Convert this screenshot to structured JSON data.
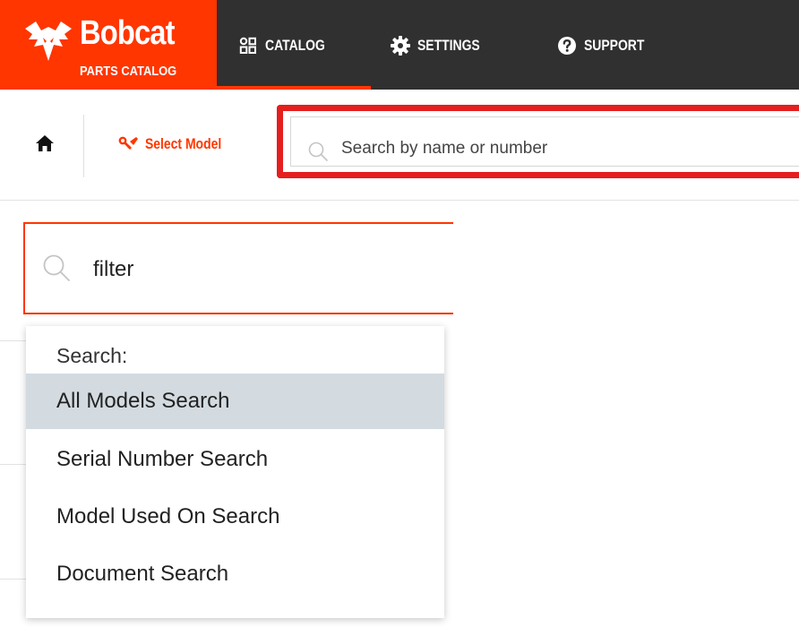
{
  "brand": {
    "name": "Bobcat",
    "subtitle": "PARTS CATALOG",
    "color": "#ff3600"
  },
  "nav": {
    "items": [
      {
        "label": "CATALOG",
        "icon": "grid-icon",
        "active": true
      },
      {
        "label": "SETTINGS",
        "icon": "gear-icon",
        "active": false
      },
      {
        "label": "SUPPORT",
        "icon": "help-circle-icon",
        "active": false
      }
    ]
  },
  "toolbar": {
    "home_icon": "home-icon",
    "select_model_label": "Select Model",
    "select_model_icon": "wrench-icon",
    "search_placeholder": "Search by name or number",
    "highlight_color": "#e51e1e"
  },
  "filter": {
    "value": "filter",
    "dropdown_header": "Search:",
    "options": [
      {
        "label": "All Models Search",
        "highlighted": true
      },
      {
        "label": "Serial Number Search",
        "highlighted": false
      },
      {
        "label": "Model Used On Search",
        "highlighted": false
      },
      {
        "label": "Document Search",
        "highlighted": false
      }
    ]
  },
  "colors": {
    "topbar": "#303030",
    "accent": "#ff3600",
    "highlight_row": "#d3dbe1"
  }
}
